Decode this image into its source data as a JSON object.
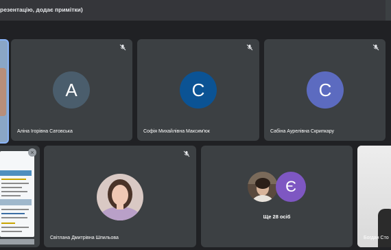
{
  "topbar": {
    "title": "резентацію, додає примітки)"
  },
  "tiles": [
    {
      "name": "Аліна Ігорівна Сатовська",
      "initial": "А",
      "avatar_color": "#4a5d6c"
    },
    {
      "name": "Софія Михайлівна Максим'юк",
      "initial": "С",
      "avatar_color": "#0b5394"
    },
    {
      "name": "Сабіна Аурелівна Скрипкару",
      "initial": "С",
      "avatar_color": "#5c6bc0"
    }
  ],
  "bottom": {
    "photo_tile_name": "Світлана Дмитрівна Шпильова",
    "more_tile": {
      "initial": "Є",
      "avatar_color": "#7e57c2",
      "label": "Ще 28 осіб"
    },
    "right_tile_name": "Богдан Сто"
  },
  "icons": {
    "mic_off": "mic-off-icon",
    "close": "close-icon"
  }
}
